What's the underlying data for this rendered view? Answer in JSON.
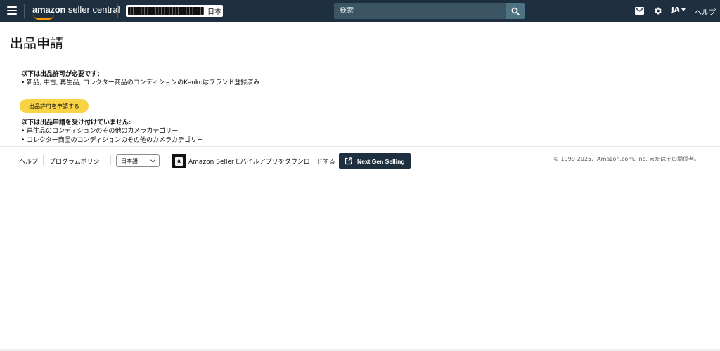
{
  "header": {
    "logo_text": "amazon seller central",
    "logo_brand": "amazon",
    "logo_rest": " seller central",
    "account_marketplace": "日本",
    "search_placeholder": "検索",
    "language": "JA",
    "help": "ヘルプ",
    "icons": [
      "menu-icon",
      "search-icon",
      "mail-icon",
      "gear-icon",
      "caret-down-icon"
    ],
    "bar_color": "#1e3040"
  },
  "main": {
    "title": "出品申請",
    "required_header": "以下は出品許可が必要です：",
    "required_items": [
      "新品, 中古, 再生品, コレクター商品のコンディションのKenkoはブランド登録済み"
    ],
    "apply_button": "出品許可を申請する",
    "not_accepted_header": "以下は出品申請を受け付けていません:",
    "not_accepted_items": [
      "再生品のコンディションのその他のカメラカテゴリー",
      "コレクター商品のコンディションのその他のカメラカテゴリー"
    ],
    "apply_button_color": "#f7d345"
  },
  "footer": {
    "help": "ヘルプ",
    "program_policy": "プログラムポリシー",
    "language_select": "日本語",
    "app_icon_letter": "a",
    "app_download": "Amazon Sellerモバイルアプリをダウンロードする",
    "next_gen": "Next Gen Selling",
    "copyright": "© 1999-2025、Amazon.com, Inc. またはその関係者。",
    "icons": [
      "amazon-seller-app-icon",
      "external-link-icon",
      "chevron-down-icon"
    ]
  }
}
